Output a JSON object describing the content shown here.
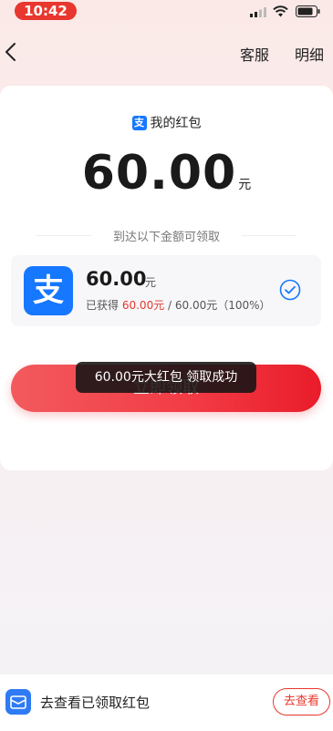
{
  "status_bar": {
    "time": "10:42"
  },
  "nav": {
    "service_label": "客服",
    "detail_label": "明细"
  },
  "card": {
    "title": "我的红包",
    "amount": "60.00",
    "unit": "元",
    "subtitle": "到达以下金额可领取"
  },
  "reward": {
    "amount": "60.00",
    "unit": "元",
    "progress_prefix": "已获得",
    "progress_current": "60.00元",
    "progress_suffix": " / 60.00元（100%）",
    "progress_fraction": 1.0
  },
  "claim_button_label": "立即领取",
  "toast": "60.00元大红包 领取成功",
  "bottom": {
    "text": "去查看已领取红包",
    "button_label": "去查看"
  },
  "colors": {
    "accent": "#e8372e",
    "alipay_blue": "#1677ff"
  },
  "icons": [
    "back-icon",
    "signal-icon",
    "wifi-icon",
    "battery-icon",
    "alipay-icon",
    "check-circle-icon",
    "envelope-icon"
  ]
}
